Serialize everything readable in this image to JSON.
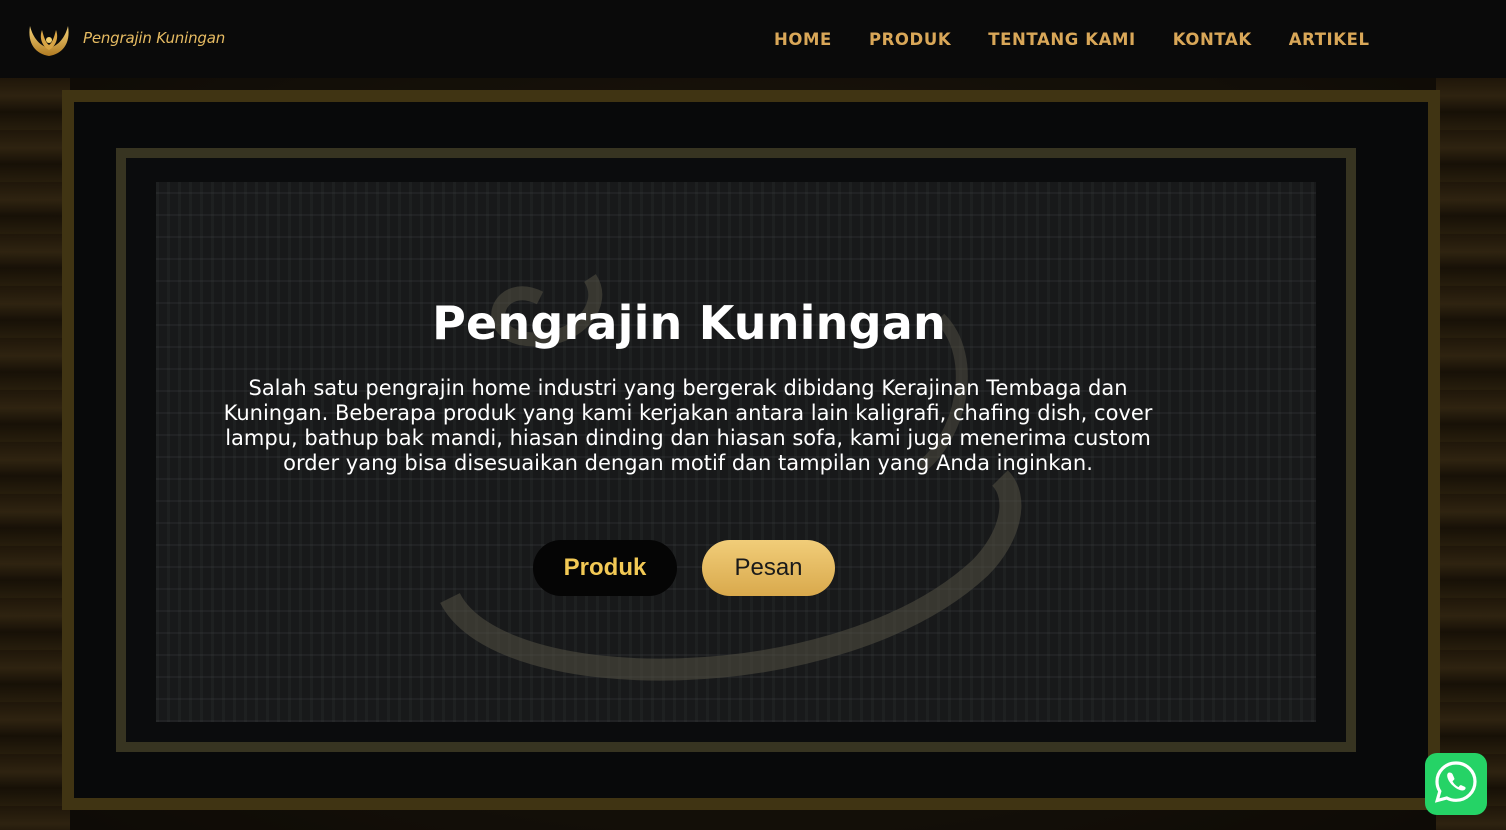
{
  "brand": {
    "logo_icon": "golden-wings-icon",
    "name": "Pengrajin Kuningan"
  },
  "nav": {
    "items": [
      {
        "label": "HOME"
      },
      {
        "label": "PRODUK"
      },
      {
        "label": "TENTANG KAMI"
      },
      {
        "label": "KONTAK"
      },
      {
        "label": "ARTIKEL"
      }
    ]
  },
  "hero": {
    "background_image": "framed-brass-calligraphy-panel",
    "title": "Pengrajin Kuningan",
    "description": "Salah satu pengrajin home industri yang bergerak dibidang Kerajinan Tembaga dan Kuningan. Beberapa produk yang kami kerjakan antara lain kaligrafi, chafing dish, cover lampu, bathup bak mandi, hiasan dinding dan hiasan sofa, kami juga menerima custom order yang bisa disesuaikan dengan motif dan tampilan yang Anda inginkan.",
    "buttons": {
      "primary_label": "Produk",
      "secondary_label": "Pesan"
    }
  },
  "floating": {
    "whatsapp_icon": "whatsapp-icon"
  },
  "colors": {
    "nav_bg": "#0a0a0a",
    "accent_gold": "#d9a758",
    "button_gold": "#e8bd63",
    "button_dark": "#050505",
    "whatsapp_green": "#25d366"
  }
}
